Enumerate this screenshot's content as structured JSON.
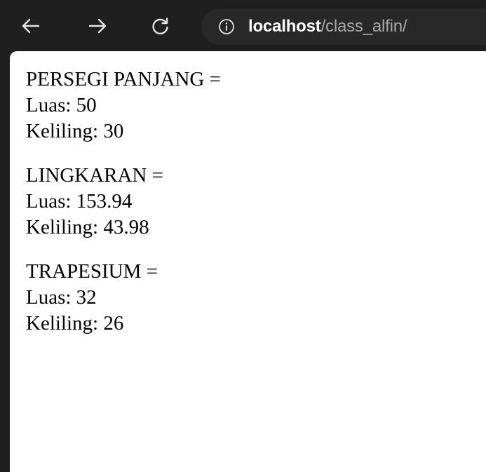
{
  "browser": {
    "url_host": "localhost",
    "url_path": "/class_alfin/",
    "icons": {
      "back": "arrow-left-icon",
      "forward": "arrow-right-icon",
      "reload": "reload-icon",
      "site_info": "info-icon"
    }
  },
  "page": {
    "shapes": [
      {
        "title": "PERSEGI PANJANG =",
        "area": "Luas: 50",
        "perimeter": "Keliling: 30"
      },
      {
        "title": "LINGKARAN =",
        "area": "Luas: 153.94",
        "perimeter": "Keliling: 43.98"
      },
      {
        "title": "TRAPESIUM =",
        "area": "Luas: 32",
        "perimeter": "Keliling: 26"
      }
    ]
  },
  "colors": {
    "toolbar_bg": "#1f1f1f",
    "omnibox_bg": "#282828",
    "icon": "#e3e3e3",
    "url_path": "#a8a8a8",
    "page_bg": "#ffffff"
  }
}
